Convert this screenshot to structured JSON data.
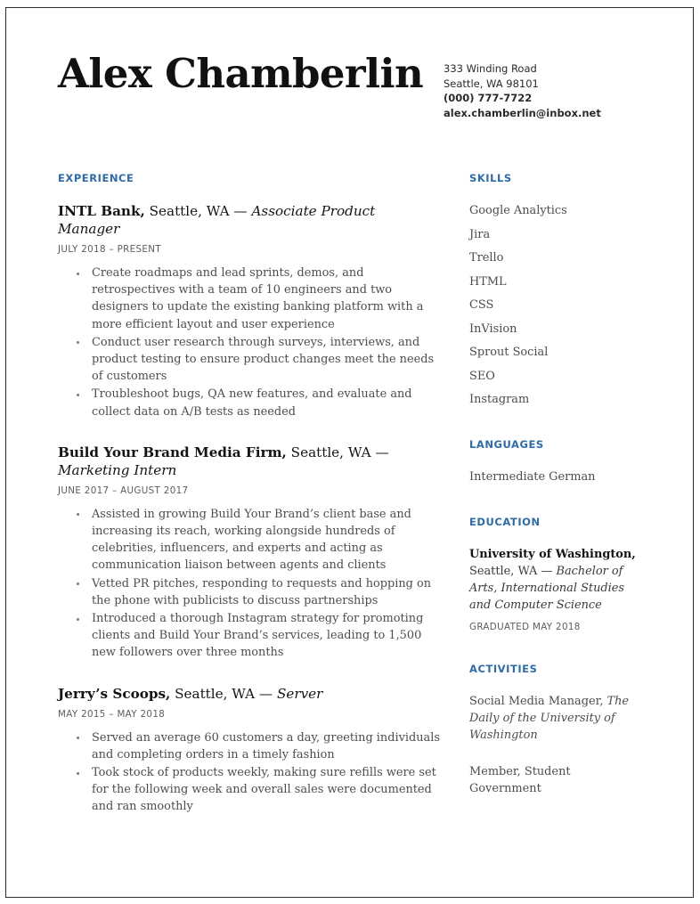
{
  "theme": {
    "accent_blue": "#2f6ca5",
    "body_text": "#4d4d4d",
    "heading_text": "#141414",
    "muted_text": "#5d5d5d",
    "page_border": "#2b2b2b",
    "background": "#ffffff"
  },
  "header": {
    "name": "Alex Chamberlin",
    "contact": {
      "street": "333 Winding Road",
      "city_state_zip": "Seattle, WA 98101",
      "phone": "(000) 777-7722",
      "email": "alex.chamberlin@inbox.net"
    }
  },
  "experience": {
    "heading": "EXPERIENCE",
    "jobs": [
      {
        "organization": "INTL Bank,",
        "location": " Seattle, WA — ",
        "role": "Associate Product Manager",
        "dates": "JULY 2018 – PRESENT",
        "bullets": [
          "Create roadmaps and lead sprints, demos, and retrospectives with a team of 10 engineers and two designers to update the existing banking platform with a more efficient layout and user experience",
          "Conduct user research through surveys, interviews, and product testing to ensure product changes meet the needs of customers",
          "Troubleshoot bugs, QA new features, and evaluate and collect data on A/B tests as needed"
        ]
      },
      {
        "organization": "Build Your Brand Media Firm,",
        "location": " Seattle, WA — ",
        "role": "Marketing Intern",
        "dates": "JUNE 2017 – AUGUST 2017",
        "bullets": [
          "Assisted in growing Build Your Brand’s client base and increasing its reach, working alongside hundreds of celebrities, influencers, and experts and acting as communication liaison between agents and clients",
          "Vetted PR pitches, responding to requests and hopping on the phone with publicists to discuss partnerships",
          "Introduced a thorough Instagram strategy for promoting clients and Build Your Brand’s services, leading to 1,500 new followers over three months"
        ]
      },
      {
        "organization": "Jerry’s Scoops,",
        "location": " Seattle, WA — ",
        "role": "Server",
        "dates": "MAY 2015 – MAY 2018",
        "bullets": [
          "Served an average 60 customers a day, greeting individuals and completing orders in a timely fashion",
          "Took stock of products weekly, making sure refills were set for the following week and overall sales were documented and ran smoothly"
        ]
      }
    ]
  },
  "skills": {
    "heading": "SKILLS",
    "items": [
      "Google Analytics",
      "Jira",
      "Trello",
      "HTML",
      "CSS",
      "InVision",
      "Sprout Social",
      "SEO",
      "Instagram"
    ]
  },
  "languages": {
    "heading": "LANGUAGES",
    "items": [
      "Intermediate German"
    ]
  },
  "education": {
    "heading": "EDUCATION",
    "school": "University of Washington,",
    "location": " Seattle, WA — ",
    "degree": "Bachelor of Arts, International Studies and Computer Science",
    "graduated": "GRADUATED MAY 2018"
  },
  "activities": {
    "heading": "ACTIVITIES",
    "items": [
      {
        "role": "Social Media Manager, ",
        "publication": "The Daily of the University of Washington"
      },
      {
        "role": "Member, Student Government",
        "publication": ""
      }
    ]
  }
}
